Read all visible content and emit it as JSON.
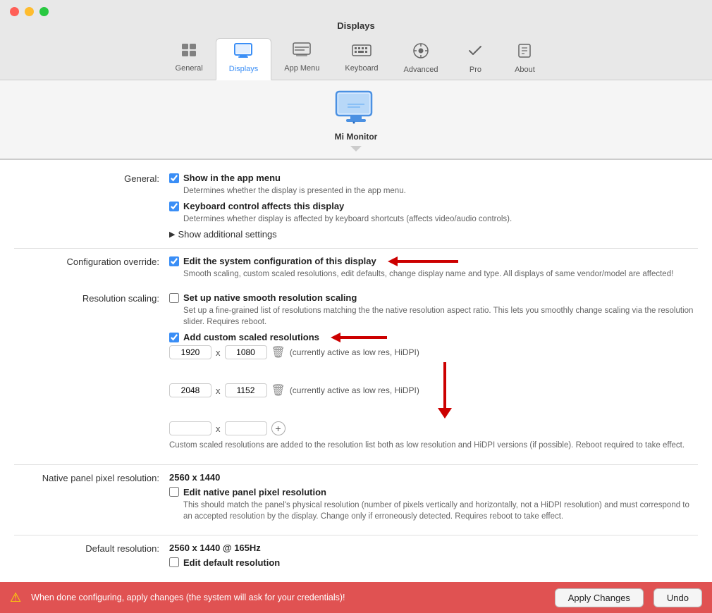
{
  "window": {
    "title": "Displays"
  },
  "nav": {
    "tabs": [
      {
        "id": "general",
        "label": "General",
        "icon": "⊞",
        "active": false
      },
      {
        "id": "displays",
        "label": "Displays",
        "icon": "🖥",
        "active": true
      },
      {
        "id": "app-menu",
        "label": "App Menu",
        "icon": "☰",
        "active": false
      },
      {
        "id": "keyboard",
        "label": "Keyboard",
        "icon": "⌨",
        "active": false
      },
      {
        "id": "advanced",
        "label": "Advanced",
        "icon": "⚙",
        "active": false
      },
      {
        "id": "pro",
        "label": "Pro",
        "icon": "✓",
        "active": false
      },
      {
        "id": "about",
        "label": "About",
        "icon": "◇",
        "active": false
      }
    ]
  },
  "monitor": {
    "name": "Mi Monitor"
  },
  "settings": {
    "general_label": "General:",
    "show_in_app_menu_label": "Show in the app menu",
    "show_in_app_menu_desc": "Determines whether the display is presented in the app menu.",
    "keyboard_control_label": "Keyboard control affects this display",
    "keyboard_control_desc": "Determines whether display is affected by keyboard shortcuts (affects video/audio controls).",
    "show_additional_label": "Show additional settings",
    "config_override_label": "Configuration override:",
    "edit_system_config_label": "Edit the system configuration of this display",
    "edit_system_config_desc": "Smooth scaling, custom scaled resolutions, edit defaults, change display name and type. All displays of same vendor/model are affected!",
    "resolution_scaling_label": "Resolution scaling:",
    "native_smooth_label": "Set up native smooth resolution scaling",
    "native_smooth_desc": "Set up a fine-grained list of resolutions matching the the native resolution aspect ratio. This lets you smoothly change scaling via the resolution slider. Requires reboot.",
    "add_custom_label": "Add custom scaled resolutions",
    "res1_w": "1920",
    "res1_h": "1080",
    "res1_note": "(currently active as low res, HiDPI)",
    "res2_w": "2048",
    "res2_h": "1152",
    "res2_note": "(currently active as low res, HiDPI)",
    "custom_res_desc": "Custom scaled resolutions are added to the resolution list both as low resolution and HiDPI versions (if possible). Reboot required to take effect.",
    "native_panel_label": "Native panel pixel resolution:",
    "native_panel_value": "2560 x 1440",
    "edit_native_label": "Edit native panel pixel resolution",
    "edit_native_desc": "This should match the panel's physical resolution (number of pixels vertically and horizontally, not a HiDPI resolution) and must correspond to an accepted resolution by the display. Change only if erroneously detected. Requires reboot to take effect.",
    "default_res_label": "Default resolution:",
    "default_res_value": "2560 x 1440 @ 165Hz",
    "edit_default_label": "Edit default resolution"
  },
  "bottom_bar": {
    "warning_text": "When done configuring, apply changes (the system will ask for your credentials)!",
    "apply_label": "Apply Changes",
    "undo_label": "Undo"
  }
}
